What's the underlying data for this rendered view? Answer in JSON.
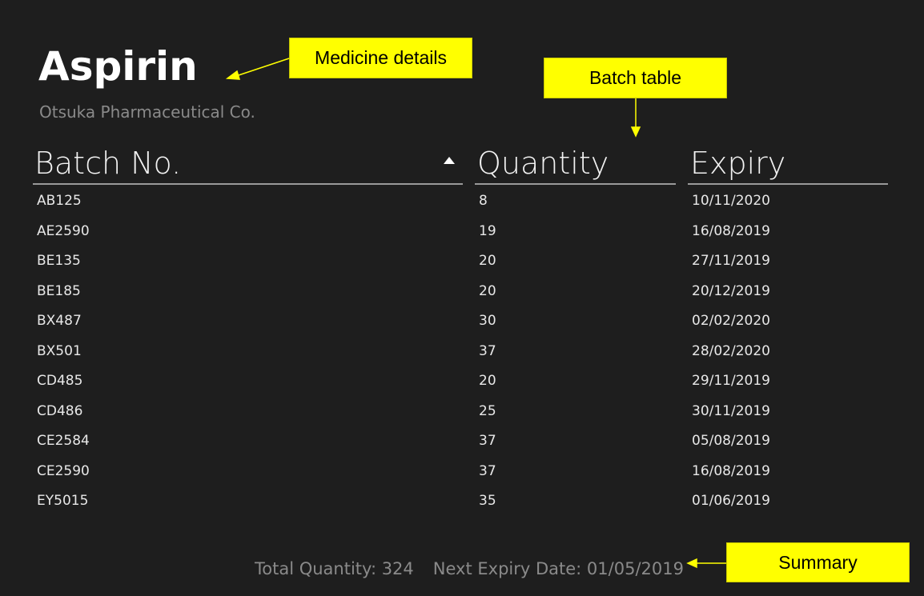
{
  "medicine": {
    "name": "Aspirin",
    "manufacturer": "Otsuka Pharmaceutical Co."
  },
  "table": {
    "headers": {
      "batch": "Batch No.",
      "quantity": "Quantity",
      "expiry": "Expiry"
    },
    "sort_icon": "sort-ascending-icon",
    "rows": [
      {
        "batch": "AB125",
        "quantity": "8",
        "expiry": "10/11/2020"
      },
      {
        "batch": "AE2590",
        "quantity": "19",
        "expiry": "16/08/2019"
      },
      {
        "batch": "BE135",
        "quantity": "20",
        "expiry": "27/11/2019"
      },
      {
        "batch": "BE185",
        "quantity": "20",
        "expiry": "20/12/2019"
      },
      {
        "batch": "BX487",
        "quantity": "30",
        "expiry": "02/02/2020"
      },
      {
        "batch": "BX501",
        "quantity": "37",
        "expiry": "28/02/2020"
      },
      {
        "batch": "CD485",
        "quantity": "20",
        "expiry": "29/11/2019"
      },
      {
        "batch": "CD486",
        "quantity": "25",
        "expiry": "30/11/2019"
      },
      {
        "batch": "CE2584",
        "quantity": "37",
        "expiry": "05/08/2019"
      },
      {
        "batch": "CE2590",
        "quantity": "37",
        "expiry": "16/08/2019"
      },
      {
        "batch": "EY5015",
        "quantity": "35",
        "expiry": "01/06/2019"
      }
    ]
  },
  "summary": {
    "total_quantity": "Total Quantity: 324",
    "next_expiry": "Next Expiry Date: 01/05/2019"
  },
  "callouts": {
    "medicine_details": "Medicine details",
    "batch_table": "Batch table",
    "summary": "Summary"
  },
  "colors": {
    "background": "#1e1e1e",
    "callout": "#ffff00",
    "muted_text": "#8a8a8a"
  }
}
